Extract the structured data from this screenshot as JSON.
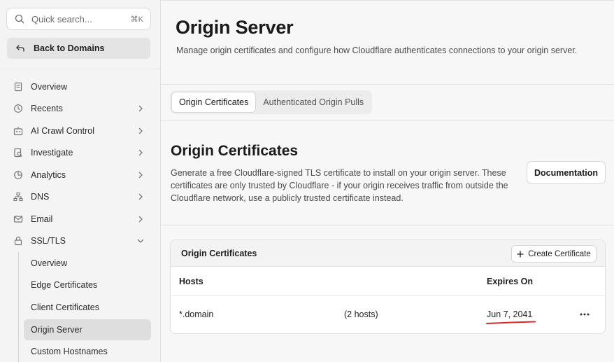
{
  "sidebar": {
    "search": {
      "placeholder": "Quick search...",
      "shortcut": "⌘K"
    },
    "back_label": "Back to Domains",
    "items": [
      {
        "label": "Overview",
        "icon": "document-icon",
        "has_chevron": false
      },
      {
        "label": "Recents",
        "icon": "history-icon",
        "has_chevron": true
      },
      {
        "label": "AI Crawl Control",
        "icon": "ai-crawl-icon",
        "has_chevron": true
      },
      {
        "label": "Investigate",
        "icon": "investigate-icon",
        "has_chevron": true
      },
      {
        "label": "Analytics",
        "icon": "analytics-icon",
        "has_chevron": true
      },
      {
        "label": "DNS",
        "icon": "dns-icon",
        "has_chevron": true
      },
      {
        "label": "Email",
        "icon": "email-icon",
        "has_chevron": true
      },
      {
        "label": "SSL/TLS",
        "icon": "lock-icon",
        "has_chevron": true,
        "expanded": true
      }
    ],
    "sub_items": [
      {
        "label": "Overview"
      },
      {
        "label": "Edge Certificates"
      },
      {
        "label": "Client Certificates"
      },
      {
        "label": "Origin Server",
        "active": true
      },
      {
        "label": "Custom Hostnames"
      }
    ]
  },
  "main": {
    "title": "Origin Server",
    "description": "Manage origin certificates and configure how Cloudflare authenticates connections to your origin server.",
    "tabs": [
      {
        "label": "Origin Certificates",
        "active": true
      },
      {
        "label": "Authenticated Origin Pulls",
        "active": false
      }
    ],
    "section": {
      "title": "Origin Certificates",
      "description": "Generate a free Cloudflare-signed TLS certificate to install on your origin server. These certificates are only trusted by Cloudflare - if your origin receives traffic from outside the Cloudflare network, use a publicly trusted certificate instead.",
      "doc_button": "Documentation"
    },
    "card": {
      "title": "Origin Certificates",
      "create_button": "Create Certificate",
      "columns": [
        "Hosts",
        "Expires On"
      ],
      "rows": [
        {
          "host": "*.domain",
          "host_count": "(2 hosts)",
          "expires": "Jun 7, 2041"
        }
      ]
    }
  },
  "colors": {
    "annotation": "#d9262b",
    "active_bg": "#dedede"
  }
}
